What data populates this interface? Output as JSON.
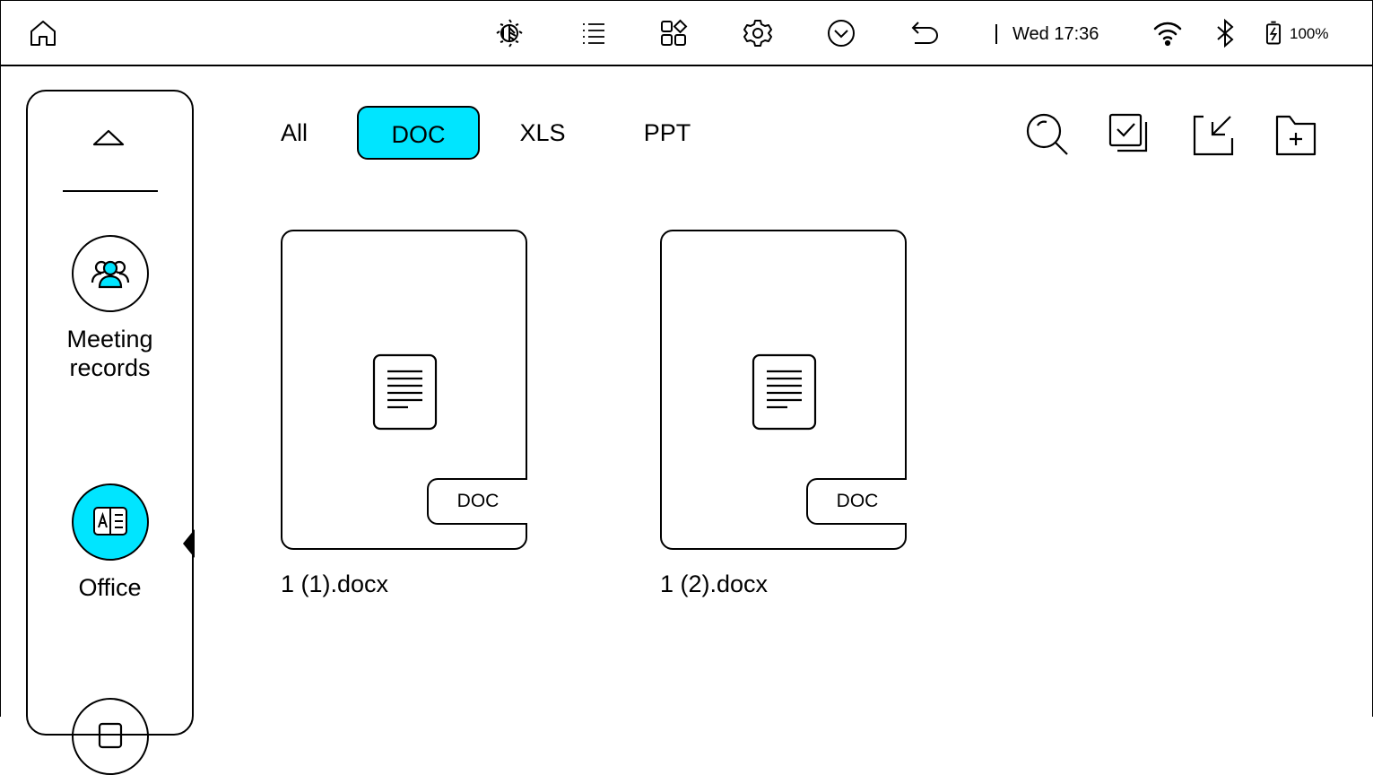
{
  "statusbar": {
    "icons": [
      "home-icon",
      "eink-refresh-icon",
      "menu-list-icon",
      "apps-grid-icon",
      "settings-icon",
      "collapse-icon",
      "back-icon",
      "wifi-icon",
      "bluetooth-icon",
      "battery-charging-icon"
    ],
    "time": "Wed 17:36",
    "battery": "100%"
  },
  "sidebar": {
    "items": [
      {
        "label": "Meeting records",
        "icon": "people-icon",
        "active": false
      },
      {
        "label": "Office",
        "icon": "office-document-icon",
        "active": true
      }
    ]
  },
  "tabs": [
    {
      "label": "All",
      "active": false
    },
    {
      "label": "DOC",
      "active": true
    },
    {
      "label": "XLS",
      "active": false
    },
    {
      "label": "PPT",
      "active": false
    }
  ],
  "toolbar": {
    "icons": [
      "search-icon",
      "multi-select-icon",
      "import-icon",
      "new-folder-icon"
    ]
  },
  "files": [
    {
      "name": "1 (1).docx",
      "type": "DOC"
    },
    {
      "name": "1 (2).docx",
      "type": "DOC"
    }
  ],
  "colors": {
    "accent": "#00e5ff",
    "ink": "#000000",
    "background": "#ffffff"
  }
}
